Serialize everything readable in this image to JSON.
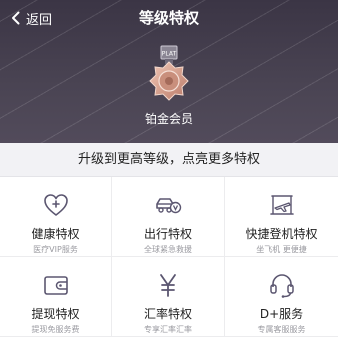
{
  "header": {
    "back_label": "返回",
    "title": "等级特权",
    "level_name": "铂金会员",
    "medal_badge": "PLAT"
  },
  "tagline": "升级到更高等级，点亮更多特权",
  "privileges": [
    {
      "title": "健康特权",
      "subtitle": "医疗VIP服务",
      "icon": "health-icon"
    },
    {
      "title": "出行特权",
      "subtitle": "全球紧急救援",
      "icon": "car-icon"
    },
    {
      "title": "快捷登机特权",
      "subtitle": "坐飞机 更便捷",
      "icon": "boarding-icon"
    },
    {
      "title": "提现特权",
      "subtitle": "提现免服务费",
      "icon": "wallet-icon"
    },
    {
      "title": "汇率特权",
      "subtitle": "专享汇率汇率",
      "icon": "yen-icon"
    },
    {
      "title": "D+服务",
      "subtitle": "专属客服服务",
      "icon": "headset-icon"
    }
  ],
  "colors": {
    "header_bg": "#46404f",
    "icon_stroke": "#5b5670",
    "medal": "#d9a28f"
  }
}
